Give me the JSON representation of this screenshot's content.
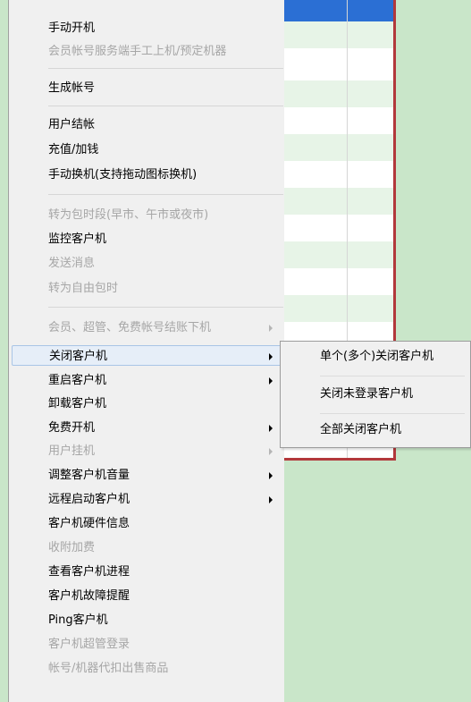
{
  "menu": {
    "items": [
      {
        "label": "手动开机",
        "disabled": false,
        "submenu": false
      },
      {
        "label": "会员帐号服务端手工上机/预定机器",
        "disabled": true,
        "submenu": false
      },
      {
        "label": "生成帐号",
        "disabled": false,
        "submenu": false
      },
      {
        "label": "用户结帐",
        "disabled": false,
        "submenu": false
      },
      {
        "label": "充值/加钱",
        "disabled": false,
        "submenu": false
      },
      {
        "label": "手动换机(支持拖动图标换机)",
        "disabled": false,
        "submenu": false
      },
      {
        "label": "转为包时段(早市、午市或夜市)",
        "disabled": true,
        "submenu": false
      },
      {
        "label": "监控客户机",
        "disabled": false,
        "submenu": false
      },
      {
        "label": "发送消息",
        "disabled": true,
        "submenu": false
      },
      {
        "label": "转为自由包时",
        "disabled": true,
        "submenu": false
      },
      {
        "label": "会员、超管、免费帐号结账下机",
        "disabled": true,
        "submenu": true
      },
      {
        "label": "关闭客户机",
        "disabled": false,
        "submenu": true
      },
      {
        "label": "重启客户机",
        "disabled": false,
        "submenu": true
      },
      {
        "label": "卸载客户机",
        "disabled": false,
        "submenu": false
      },
      {
        "label": "免费开机",
        "disabled": false,
        "submenu": true
      },
      {
        "label": "用户挂机",
        "disabled": true,
        "submenu": true
      },
      {
        "label": "调整客户机音量",
        "disabled": false,
        "submenu": true
      },
      {
        "label": "远程启动客户机",
        "disabled": false,
        "submenu": true
      },
      {
        "label": "客户机硬件信息",
        "disabled": false,
        "submenu": false
      },
      {
        "label": "收附加费",
        "disabled": true,
        "submenu": false
      },
      {
        "label": "查看客户机进程",
        "disabled": false,
        "submenu": false
      },
      {
        "label": "客户机故障提醒",
        "disabled": false,
        "submenu": false
      },
      {
        "label": "Ping客户机",
        "disabled": false,
        "submenu": false
      },
      {
        "label": "客户机超管登录",
        "disabled": true,
        "submenu": false
      },
      {
        "label": "帐号/机器代扣出售商品",
        "disabled": true,
        "submenu": false
      }
    ]
  },
  "submenu": {
    "items": [
      {
        "label": "单个(多个)关闭客户机"
      },
      {
        "label": "关闭未登录客户机"
      },
      {
        "label": "全部关闭客户机"
      }
    ]
  },
  "colors": {
    "menu_bg": "#f0f0f0",
    "disabled_text": "#a6a6a6",
    "hover_bg": "#e6eef8",
    "window_border": "#b2383b",
    "background_green": "#c9e6c9",
    "selection_blue": "#2b6fd4"
  }
}
